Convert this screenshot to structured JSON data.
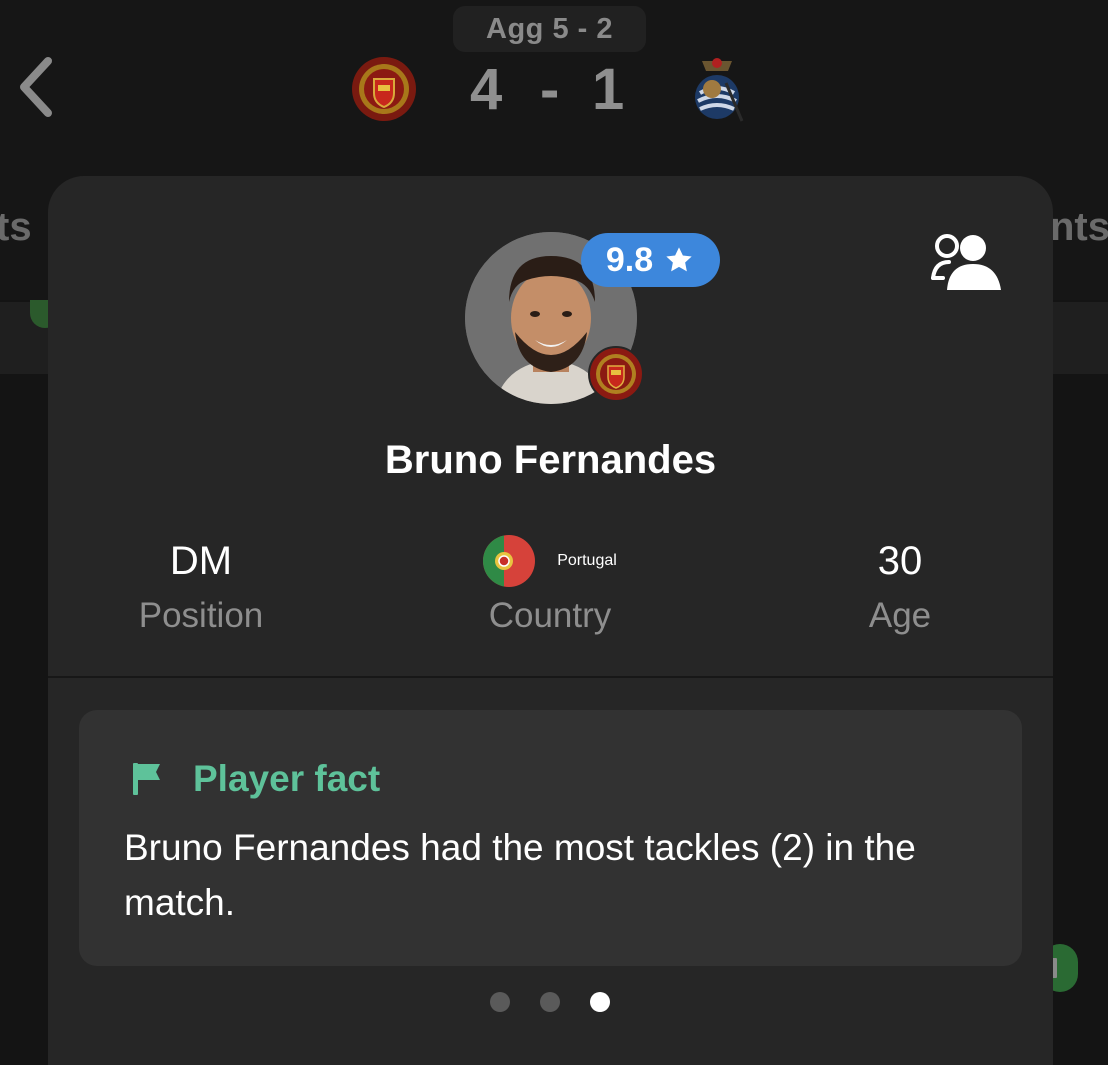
{
  "header": {
    "aggregate": "Agg 5 - 2",
    "home_score": "4",
    "separator": "-",
    "away_score": "1",
    "left_tab": "ts",
    "right_tab": "nts"
  },
  "player": {
    "name": "Bruno Fernandes",
    "rating": "9.8",
    "stats": [
      {
        "value": "DM",
        "label": "Position"
      },
      {
        "value": "Portugal",
        "label": "Country"
      },
      {
        "value": "30",
        "label": "Age"
      }
    ]
  },
  "fact": {
    "title": "Player fact",
    "text": "Bruno Fernandes had the most tackles (2) in the match."
  },
  "pager": {
    "count": 3,
    "active_index": 2
  },
  "icons": {
    "back": "chevron-left-icon",
    "compare": "compare-players-icon",
    "rating": "star-icon",
    "fact": "flag-icon"
  },
  "colors": {
    "rating_badge": "#3d87dc",
    "fact_accent": "#5ec29a",
    "card_bg": "#262626"
  }
}
